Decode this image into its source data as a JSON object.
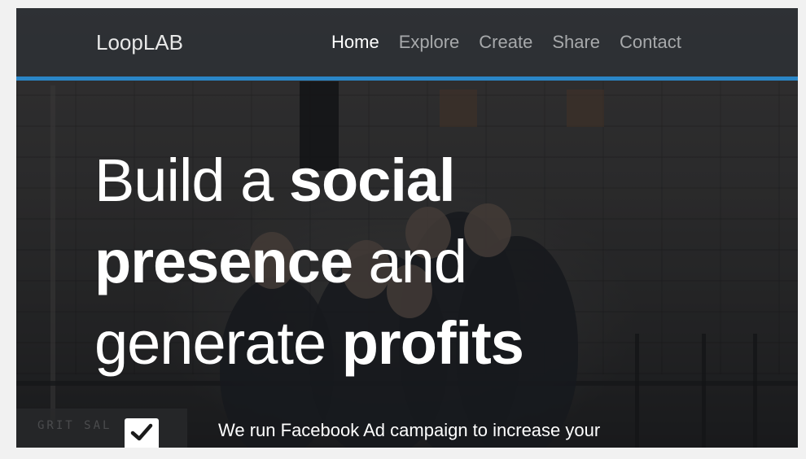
{
  "brand": {
    "name": "LoopLAB"
  },
  "nav": {
    "items": [
      {
        "label": "Home",
        "active": true
      },
      {
        "label": "Explore",
        "active": false
      },
      {
        "label": "Create",
        "active": false
      },
      {
        "label": "Share",
        "active": false
      },
      {
        "label": "Contact",
        "active": false
      }
    ]
  },
  "hero": {
    "line1_light": "Build a ",
    "line1_bold": "social",
    "line2_bold": "presence",
    "line2_light": " and",
    "line3_light": "generate ",
    "line3_bold": "profits",
    "background_sign_text": "GRIT SAL",
    "feature": {
      "icon": "checkmark-icon",
      "text": "We run Facebook Ad campaign to increase your"
    }
  },
  "colors": {
    "accent": "#2a86c7",
    "nav_text": "#a7a9ab",
    "nav_active": "#ffffff",
    "navbar_bg": "#2e3136"
  }
}
